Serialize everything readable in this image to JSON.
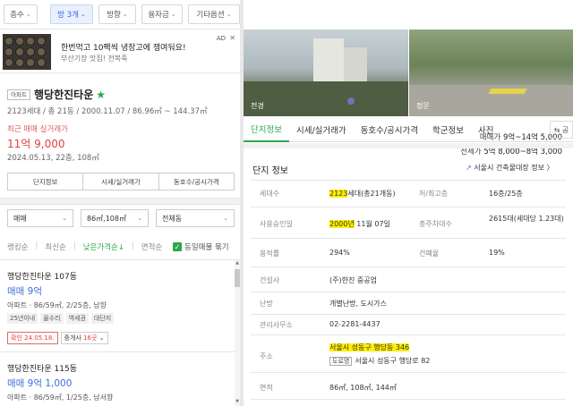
{
  "filters": [
    {
      "label": "층수",
      "active": false
    },
    {
      "label": "방 3개",
      "active": true
    },
    {
      "label": "방향",
      "active": false
    },
    {
      "label": "융자금",
      "active": false
    },
    {
      "label": "기타옵션",
      "active": false
    }
  ],
  "ad": {
    "title": "한번먹고 10팩씩 냉장고에 쟁여둬요!",
    "subtitle": "부산기장 맛집! 전복죽",
    "badge": "AD"
  },
  "complex": {
    "type_tag": "아파트",
    "name": "행당한진타운",
    "meta": "2123세대 / 총 21동 / 2000.11.07 / 86.96㎡ ~ 144.37㎡",
    "recent_label": "최근 매매 실거래가",
    "recent_price": "11억 9,000",
    "recent_date": "2024.05.13, 22층, 108㎡",
    "sale_label": "매매가",
    "sale_range": "9억~14억 5,000",
    "jeonse_label": "전세가",
    "jeonse_range": "5억 8,000~8억 3,000",
    "tabs": [
      "단지정보",
      "시세/실거래가",
      "동호수/공시가격"
    ]
  },
  "selects": {
    "trade": "매매",
    "area": "86㎡,108㎡",
    "dong": "전체동"
  },
  "sort": {
    "options": [
      "랭킹순",
      "최신순",
      "낮은가격순↓",
      "면적순"
    ],
    "active_index": 2,
    "same_listing_label": "동일매물 묶기"
  },
  "listings": [
    {
      "name": "행당한진타운 107동",
      "price": "매매 9억",
      "spec": "아파트 · 86/59㎡, 2/25층, 남향",
      "chips": [
        "25년이내",
        "올수리",
        "역세권",
        "대단지"
      ],
      "confirm_date": "확인 24.05.18.",
      "broker_prefix": "중개사 ",
      "broker_count": "16곳"
    },
    {
      "name": "행당한진타운 115동",
      "price": "매매 9억 1,000",
      "spec": "아파트 · 86/59㎡, 1/25층, 남서향"
    }
  ],
  "photos": {
    "left_label": "전경",
    "right_label": "정문"
  },
  "right_tabs": [
    "단지정보",
    "시세/실거래가",
    "동호수/공시가격",
    "학군정보",
    "사진"
  ],
  "share_label": "⇆ 공",
  "detail": {
    "title": "단지 정보",
    "link": "서울시 건축물대장 정보 〉",
    "households_label": "세대수",
    "households_hl": "2123",
    "households_rest": "세대(총21개동)",
    "floors_label": "저/최고층",
    "floors_value": "16층/25층",
    "approval_label": "사용승인일",
    "approval_hl": "2000년",
    "approval_rest": " 11월 07일",
    "parking_label": "총주차대수",
    "parking_value": "2615대(세대당 1.23대)",
    "far_label": "용적률",
    "far_value": "294%",
    "bcr_label": "건폐율",
    "bcr_value": "19%",
    "builder_label": "건설사",
    "builder_value": "(주)한진 중공업",
    "heating_label": "난방",
    "heating_value": "개별난방, 도시가스",
    "office_label": "관리사무소",
    "office_value": "02-2281-4437",
    "address_label": "주소",
    "address_value": "서울시 성동구 행당동 346",
    "road_tag": "도로명",
    "road_value": "서울시 성동구 행당로 82",
    "area_label": "면적",
    "area_value": "86㎡, 108㎡, 144㎡"
  },
  "colors": {
    "accent_green": "#2aa84a",
    "price_red": "#e14040",
    "price_blue": "#3c6fd8",
    "highlight": "#ffef00"
  }
}
